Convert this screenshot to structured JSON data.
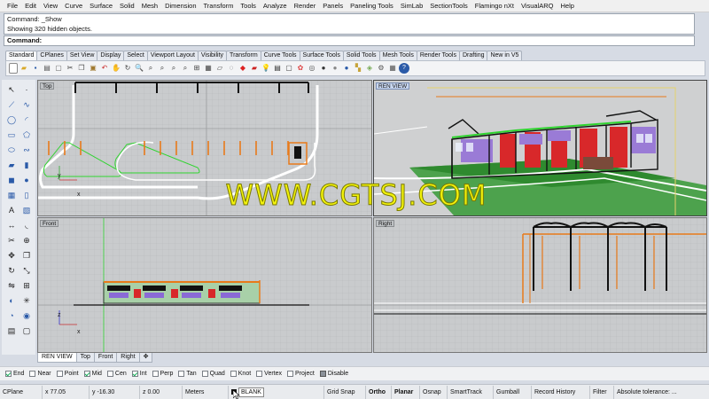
{
  "menu": [
    "File",
    "Edit",
    "View",
    "Curve",
    "Surface",
    "Solid",
    "Mesh",
    "Dimension",
    "Transform",
    "Tools",
    "Analyze",
    "Render",
    "Panels",
    "Paneling Tools",
    "SimLab",
    "SectionTools",
    "Flamingo nXt",
    "VisualARQ",
    "Help"
  ],
  "command_history": [
    "Command: _Show",
    "Showing 320 hidden objects."
  ],
  "command_prompt": "Command:",
  "toolbar_tabs": [
    "Standard",
    "CPlanes",
    "Set View",
    "Display",
    "Select",
    "Viewport Layout",
    "Visibility",
    "Transform",
    "Curve Tools",
    "Surface Tools",
    "Solid Tools",
    "Mesh Tools",
    "Render Tools",
    "Drafting",
    "New in V5"
  ],
  "viewports": {
    "top": "Top",
    "ren_view": "REN VIEW",
    "front": "Front",
    "right": "Right"
  },
  "viewport_tabs": [
    "REN VIEW",
    "Top",
    "Front",
    "Right"
  ],
  "osnaps": [
    {
      "label": "End",
      "checked": true
    },
    {
      "label": "Near",
      "checked": false
    },
    {
      "label": "Point",
      "checked": false
    },
    {
      "label": "Mid",
      "checked": true
    },
    {
      "label": "Cen",
      "checked": false
    },
    {
      "label": "Int",
      "checked": true
    },
    {
      "label": "Perp",
      "checked": false
    },
    {
      "label": "Tan",
      "checked": false
    },
    {
      "label": "Quad",
      "checked": false
    },
    {
      "label": "Knot",
      "checked": false
    },
    {
      "label": "Vertex",
      "checked": false
    },
    {
      "label": "Project",
      "checked": false
    }
  ],
  "disable_label": "Disable",
  "status": {
    "cplane": "CPlane",
    "x": "x 77.05",
    "y": "y -16.30",
    "z": "z 0.00",
    "units": "Meters",
    "layer": "BLANK",
    "grid_snap": "Grid Snap",
    "ortho": "Ortho",
    "planar": "Planar",
    "osnap": "Osnap",
    "smarttrack": "SmartTrack",
    "gumball": "Gumball",
    "record_history": "Record History",
    "filter": "Filter",
    "tolerance": "Absolute tolerance: ..."
  },
  "watermark": "WWW.CGTSJ.COM",
  "axis": {
    "x": "x",
    "y": "y",
    "z": "z"
  },
  "colors": {
    "accent_green": "#2fd42f",
    "accent_orange": "#e87a1a",
    "building_red": "#d8282a",
    "watermark": "#f2f20c"
  }
}
